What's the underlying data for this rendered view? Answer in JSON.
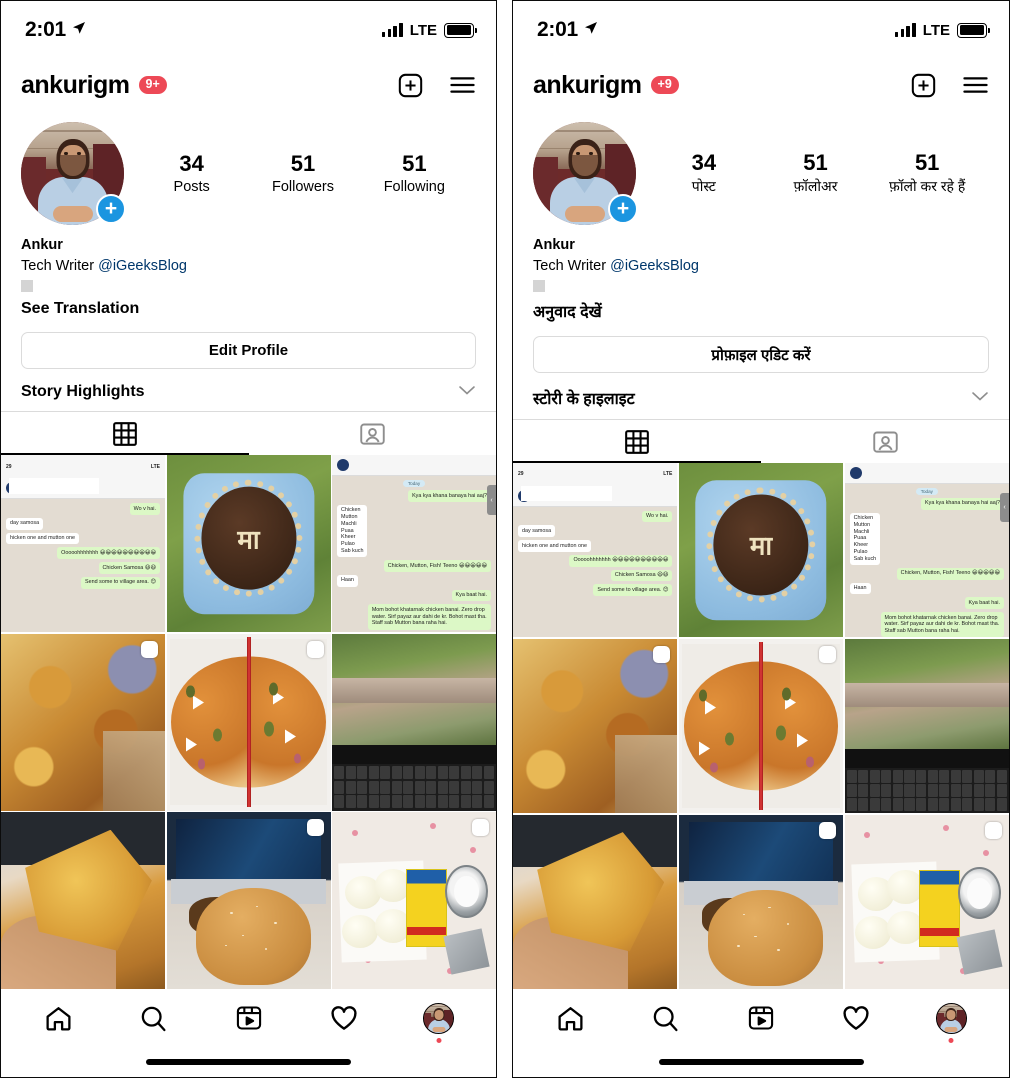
{
  "panels": [
    {
      "id": "english",
      "status": {
        "time": "2:01",
        "location_icon": "location-arrow-icon",
        "carrier": "LTE"
      },
      "header": {
        "username": "ankurigm",
        "badge": "9+",
        "add_icon": "plus-square-icon",
        "menu_icon": "hamburger-menu-icon"
      },
      "stats": [
        {
          "value": "34",
          "label": "Posts"
        },
        {
          "value": "51",
          "label": "Followers"
        },
        {
          "value": "51",
          "label": "Following"
        }
      ],
      "bio": {
        "name": "Ankur",
        "role": "Tech Writer ",
        "mention": "@iGeeksBlog",
        "see_translation": "See Translation"
      },
      "edit_profile": "Edit Profile",
      "highlights": "Story Highlights",
      "tabs": [
        {
          "name": "grid-tab",
          "icon": "grid-icon",
          "active": true
        },
        {
          "name": "tagged-tab",
          "icon": "tagged-person-icon",
          "active": false
        }
      ],
      "nav": [
        {
          "name": "home",
          "icon": "home-icon"
        },
        {
          "name": "search",
          "icon": "search-icon"
        },
        {
          "name": "reels",
          "icon": "reels-icon"
        },
        {
          "name": "activity",
          "icon": "heart-icon"
        },
        {
          "name": "profile",
          "icon": "profile-avatar-icon"
        }
      ]
    },
    {
      "id": "hindi",
      "status": {
        "time": "2:01",
        "location_icon": "location-arrow-icon",
        "carrier": "LTE"
      },
      "header": {
        "username": "ankurigm",
        "badge": "+9",
        "add_icon": "plus-square-icon",
        "menu_icon": "hamburger-menu-icon"
      },
      "stats": [
        {
          "value": "34",
          "label": "पोस्ट"
        },
        {
          "value": "51",
          "label": "फ़ॉलोअर"
        },
        {
          "value": "51",
          "label": "फ़ॉलो कर रहे हैं"
        }
      ],
      "bio": {
        "name": "Ankur",
        "role": "Tech Writer ",
        "mention": "@iGeeksBlog",
        "see_translation": "अनुवाद देखें"
      },
      "edit_profile": "प्रोफ़ाइल एडिट करें",
      "highlights": "स्टोरी के हाइलाइट",
      "tabs": [
        {
          "name": "grid-tab",
          "icon": "grid-icon",
          "active": true
        },
        {
          "name": "tagged-tab",
          "icon": "tagged-person-icon",
          "active": false
        }
      ],
      "nav": [
        {
          "name": "home",
          "icon": "home-icon"
        },
        {
          "name": "search",
          "icon": "search-icon"
        },
        {
          "name": "reels",
          "icon": "reels-icon"
        },
        {
          "name": "activity",
          "icon": "heart-icon"
        },
        {
          "name": "profile",
          "icon": "profile-avatar-icon"
        }
      ]
    }
  ],
  "grid": [
    {
      "kind": "whatsapp-chat-a",
      "multi": false,
      "alt": "WhatsApp chat screenshot about samosa and chicken"
    },
    {
      "kind": "cake",
      "multi": false,
      "alt": "Chocolate cake with cashews on blue plate"
    },
    {
      "kind": "whatsapp-chat-b",
      "multi": false,
      "alt": "WhatsApp chat screenshot listing food items"
    },
    {
      "kind": "biryani",
      "multi": true,
      "alt": "Plate of biryani with chicken"
    },
    {
      "kind": "pizza",
      "multi": true,
      "alt": "Pizza cut in half on a box"
    },
    {
      "kind": "laptop-video",
      "multi": false,
      "alt": "Laptop screen showing outdoor parade video"
    },
    {
      "kind": "pizza-slice",
      "multi": false,
      "alt": "Hand holding a pizza slice over a laptop"
    },
    {
      "kind": "burger",
      "multi": true,
      "alt": "Bitten burger in front of laptop screen"
    },
    {
      "kind": "eggs",
      "multi": true,
      "alt": "Boiled eggs with a masala packet and steel bowl"
    }
  ],
  "whatsapp_a": {
    "time": "29",
    "carrier": "LTE",
    "messages": [
      {
        "from": "me",
        "text": "Wo v hai."
      },
      {
        "from": "you",
        "text": "day samosa"
      },
      {
        "from": "you",
        "text": "hicken one and mutton one"
      },
      {
        "from": "me",
        "text": "Ooooohhhhhhh 😀😀😀😀😀😀😀😀😀😀"
      },
      {
        "from": "me",
        "text": "Chicken Samosa 😆😆"
      },
      {
        "from": "me",
        "text": "Send some to village area. 😊"
      }
    ]
  },
  "whatsapp_b": {
    "day_pill": "Today",
    "messages": [
      {
        "from": "me",
        "text": "Kya kya khana banaya hai aaj?"
      },
      {
        "from": "you",
        "text": "Chicken\nMutton\nMachli\nPuaa\nKheer\nPulao\nSab kuch"
      },
      {
        "from": "me",
        "text": "Chicken, Mutton, Fish! Teeno 😀😀😀😀😀"
      },
      {
        "from": "you",
        "text": "Haan"
      },
      {
        "from": "me",
        "text": "Kya baat hai."
      },
      {
        "from": "me",
        "text": "Mom bohot khatarnak chicken banai. Zero drop water. Sirf payaz aur dahi de kr. Bohot mast tha. Staff sab Mutton bana raha hai."
      }
    ]
  },
  "cake_letter": "मा",
  "colors": {
    "badge_red": "#ed4956",
    "plus_blue": "#1b95e0",
    "link_blue": "#00376b",
    "border_grey": "#dbdbdb",
    "active_black": "#000000",
    "inactive_grey": "#8e8e8e"
  }
}
